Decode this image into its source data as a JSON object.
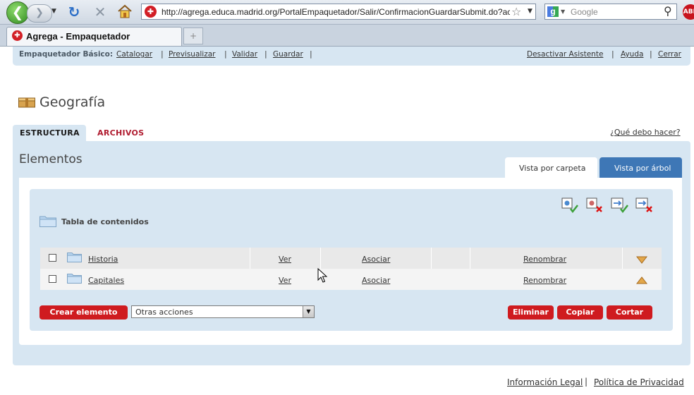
{
  "browser": {
    "url": "http://agrega.educa.madrid.org/PortalEmpaquetador/Salir/ConfirmacionGuardarSubmit.do?action=Car",
    "search_placeholder": "Google",
    "tab_title": "Agrega - Empaquetador",
    "icons": {
      "back": "back-arrow-icon",
      "forward": "forward-arrow-icon",
      "reload": "reload-icon",
      "stop": "stop-icon",
      "home": "home-icon",
      "bookmark": "star-icon",
      "search": "magnifier-icon",
      "adblock": "adblock-icon"
    },
    "adblock_label": "ABP"
  },
  "topbar": {
    "label": "Empaquetador Básico:",
    "links": [
      "Catalogar",
      "Previsualizar",
      "Validar",
      "Guardar"
    ],
    "right_links": [
      "Desactivar Asistente",
      "Ayuda",
      "Cerrar"
    ]
  },
  "page": {
    "title": "Geografía",
    "tabs": [
      "ESTRUCTURA",
      "ARCHIVOS"
    ],
    "help_link": "¿Qué debo hacer?",
    "section_title": "Elementos",
    "view_tabs": [
      "Vista por carpeta",
      "Vista por árbol"
    ],
    "toc_label": "Tabla de contenidos",
    "rows": [
      {
        "name": "Historia",
        "view": "Ver",
        "associate": "Asociar",
        "rename": "Renombrar",
        "arrow": "down"
      },
      {
        "name": "Capitales",
        "view": "Ver",
        "associate": "Asociar",
        "rename": "Renombrar",
        "arrow": "up"
      }
    ],
    "create_button": "Crear elemento",
    "actions_select": "Otras acciones",
    "buttons": [
      "Eliminar",
      "Copiar",
      "Cortar"
    ]
  },
  "footer": {
    "links": [
      "Información Legal",
      "Política de Privacidad"
    ]
  },
  "colors": {
    "panel": "#d7e6f2",
    "accent_red": "#cf1b1f",
    "tab_blue": "#3e77b6",
    "archivos_red": "#b01c30"
  }
}
